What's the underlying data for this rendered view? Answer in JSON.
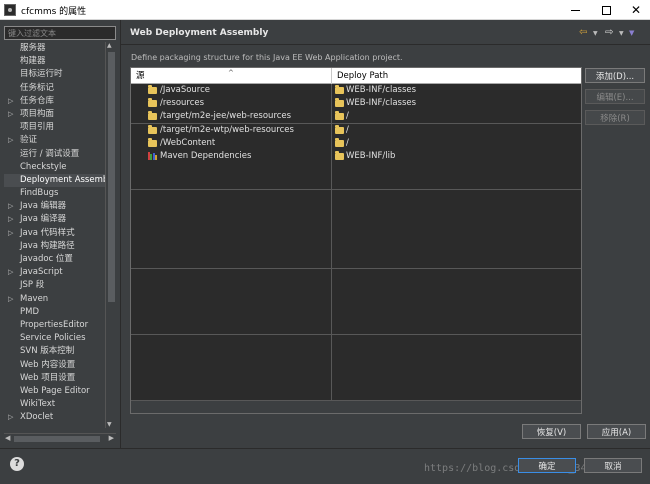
{
  "window": {
    "title": "cfcmms 的属性"
  },
  "filter": {
    "placeholder": "键入过滤文本"
  },
  "sidebar": {
    "items": [
      {
        "label": "服务器",
        "expandable": false
      },
      {
        "label": "构建器",
        "expandable": false
      },
      {
        "label": "目标运行时",
        "expandable": false
      },
      {
        "label": "任务标记",
        "expandable": false
      },
      {
        "label": "任务仓库",
        "expandable": true
      },
      {
        "label": "项目构面",
        "expandable": true
      },
      {
        "label": "项目引用",
        "expandable": false
      },
      {
        "label": "验证",
        "expandable": true
      },
      {
        "label": "运行 / 调试设置",
        "expandable": false
      },
      {
        "label": "Checkstyle",
        "expandable": false
      },
      {
        "label": "Deployment Assembly",
        "expandable": false,
        "selected": true
      },
      {
        "label": "FindBugs",
        "expandable": false
      },
      {
        "label": "Java 编辑器",
        "expandable": true
      },
      {
        "label": "Java 编译器",
        "expandable": true
      },
      {
        "label": "Java 代码样式",
        "expandable": true
      },
      {
        "label": "Java 构建路径",
        "expandable": false
      },
      {
        "label": "Javadoc 位置",
        "expandable": false
      },
      {
        "label": "JavaScript",
        "expandable": true
      },
      {
        "label": "JSP 段",
        "expandable": false
      },
      {
        "label": "Maven",
        "expandable": true
      },
      {
        "label": "PMD",
        "expandable": false
      },
      {
        "label": "PropertiesEditor",
        "expandable": false
      },
      {
        "label": "Service Policies",
        "expandable": false
      },
      {
        "label": "SVN 版本控制",
        "expandable": false
      },
      {
        "label": "Web 内容设置",
        "expandable": false
      },
      {
        "label": "Web 项目设置",
        "expandable": false
      },
      {
        "label": "Web Page Editor",
        "expandable": false
      },
      {
        "label": "WikiText",
        "expandable": false
      },
      {
        "label": "XDoclet",
        "expandable": true
      }
    ]
  },
  "page": {
    "title": "Web Deployment Assembly",
    "description": "Define packaging structure for this Java EE Web Application project."
  },
  "table": {
    "columns": [
      "源",
      "Deploy Path"
    ],
    "rows": [
      {
        "source": "/JavaSource",
        "icon": "folder-icon",
        "path": "WEB-INF/classes"
      },
      {
        "source": "/resources",
        "icon": "folder-icon",
        "path": "WEB-INF/classes"
      },
      {
        "source": "/target/m2e-jee/web-resources",
        "icon": "folder-icon",
        "path": "/"
      },
      {
        "source": "/target/m2e-wtp/web-resources",
        "icon": "folder-icon",
        "path": "/"
      },
      {
        "source": "/WebContent",
        "icon": "folder-icon",
        "path": "/"
      },
      {
        "source": "Maven Dependencies",
        "icon": "library-icon",
        "path": "WEB-INF/lib"
      }
    ],
    "empty_rows": 18
  },
  "buttons": {
    "add": "添加(D)...",
    "edit": "编辑(E)...",
    "remove": "移除(R)",
    "restore": "恢复(V)",
    "apply": "应用(A)",
    "ok": "确定",
    "cancel": "取消"
  },
  "watermark": "https://blog.csdn.net/qq_34...1788",
  "colors": {
    "background": "#3c3f41",
    "table_fill": "#2b2b2b",
    "folder": "#e8c45a",
    "back_arrow": "#d2a23a"
  }
}
